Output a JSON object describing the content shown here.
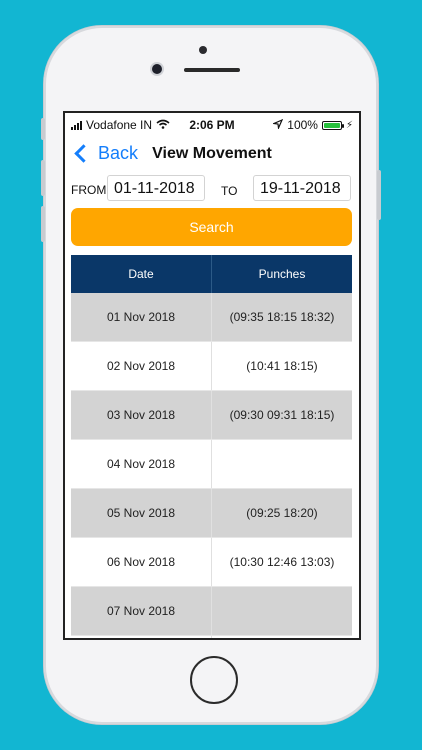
{
  "status_bar": {
    "carrier": "Vodafone IN",
    "time": "2:06 PM",
    "battery": "100%",
    "colors": {
      "battery_fill": "#27c13c"
    }
  },
  "nav": {
    "back_label": "Back",
    "title": "View Movement",
    "colors": {
      "back": "#147efb"
    }
  },
  "filter": {
    "from_label": "FROM",
    "from_value": "01-11-2018",
    "to_label": "TO",
    "to_value": "19-11-2018",
    "search_label": "Search",
    "colors": {
      "search_button": "#ffa600"
    }
  },
  "table": {
    "headers": [
      "Date",
      "Punches"
    ],
    "rows": [
      {
        "date": "01 Nov 2018",
        "punches": "(09:35  18:15  18:32)"
      },
      {
        "date": "02 Nov 2018",
        "punches": "(10:41  18:15)"
      },
      {
        "date": "03 Nov 2018",
        "punches": "(09:30  09:31  18:15)"
      },
      {
        "date": "04 Nov 2018",
        "punches": ""
      },
      {
        "date": "05 Nov 2018",
        "punches": "(09:25  18:20)"
      },
      {
        "date": "06 Nov 2018",
        "punches": "(10:30  12:46  13:03)"
      },
      {
        "date": "07 Nov 2018",
        "punches": ""
      }
    ],
    "colors": {
      "header_bg": "#0a3768",
      "shaded_row": "#d3d3d3"
    }
  }
}
